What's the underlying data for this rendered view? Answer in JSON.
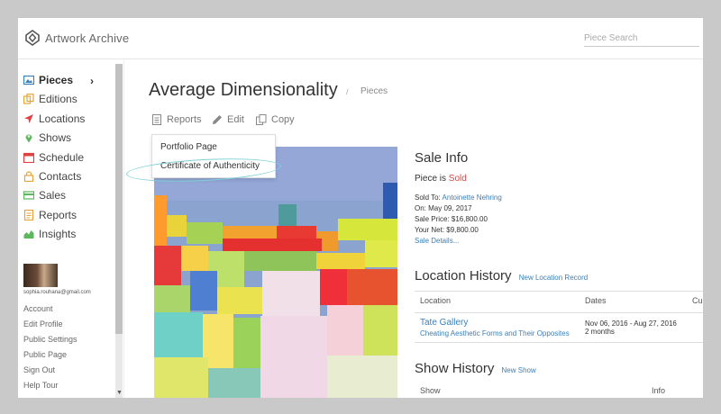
{
  "app": {
    "name": "Artwork Archive",
    "search_placeholder": "Piece Search"
  },
  "sidebar": {
    "items": [
      {
        "label": "Pieces",
        "icon": "image-icon",
        "color": "#3a7fb8"
      },
      {
        "label": "Editions",
        "icon": "editions-icon",
        "color": "#e8a33a"
      },
      {
        "label": "Locations",
        "icon": "location-arrow-icon",
        "color": "#e04040"
      },
      {
        "label": "Shows",
        "icon": "map-pin-icon",
        "color": "#5cb85c"
      },
      {
        "label": "Schedule",
        "icon": "calendar-icon",
        "color": "#e04040"
      },
      {
        "label": "Contacts",
        "icon": "lock-icon",
        "color": "#e8a33a"
      },
      {
        "label": "Sales",
        "icon": "card-icon",
        "color": "#5cb85c"
      },
      {
        "label": "Reports",
        "icon": "report-icon",
        "color": "#e8a33a"
      },
      {
        "label": "Insights",
        "icon": "chart-icon",
        "color": "#5cb85c"
      }
    ],
    "email": "sophia.rouhana@gmail.com",
    "account_links": [
      "Account",
      "Edit Profile",
      "Public Settings",
      "Public Page",
      "Sign Out",
      "Help Tour"
    ]
  },
  "main": {
    "title": "Average Dimensionality",
    "breadcrumb_sep": "/",
    "breadcrumb": "Pieces",
    "actions": {
      "reports": "Reports",
      "edit": "Edit",
      "copy": "Copy"
    },
    "dropdown": {
      "items": [
        "Portfolio Page",
        "Certificate of Authenticity"
      ]
    },
    "sale_info": {
      "heading": "Sale Info",
      "status_prefix": "Piece is",
      "status": "Sold",
      "sold_to_label": "Sold To:",
      "sold_to": "Antoinette Nehring",
      "on": "On: May 09, 2017",
      "sale_price": "Sale Price: $16,800.00",
      "your_net": "Your Net: $9,800.00",
      "details_link": "Sale Details..."
    },
    "location_history": {
      "heading": "Location History",
      "new_link": "New Location Record",
      "columns": [
        "Location",
        "Dates",
        "Cu"
      ],
      "row": {
        "name": "Tate Gallery",
        "show": "Cheating Aesthetic Forms and Their Opposites",
        "dates": "Nov 06, 2016 - Aug 27, 2016",
        "duration": "2 months"
      }
    },
    "show_history": {
      "heading": "Show History",
      "new_link": "New Show",
      "columns": [
        "Show",
        "Info"
      ]
    }
  }
}
